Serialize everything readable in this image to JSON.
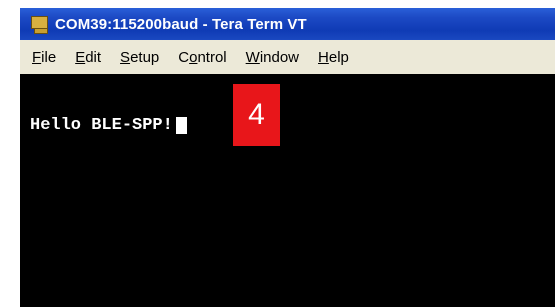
{
  "window": {
    "title": "COM39:115200baud - Tera Term VT"
  },
  "menu": [
    {
      "pre": "",
      "key": "F",
      "post": "ile"
    },
    {
      "pre": "",
      "key": "E",
      "post": "dit"
    },
    {
      "pre": "",
      "key": "S",
      "post": "etup"
    },
    {
      "pre": "C",
      "key": "o",
      "post": "ntrol"
    },
    {
      "pre": "",
      "key": "W",
      "post": "indow"
    },
    {
      "pre": "",
      "key": "H",
      "post": "elp"
    }
  ],
  "terminal": {
    "text": "Hello BLE-SPP!"
  },
  "annotation": {
    "label": "4",
    "color": "#e8161a"
  }
}
